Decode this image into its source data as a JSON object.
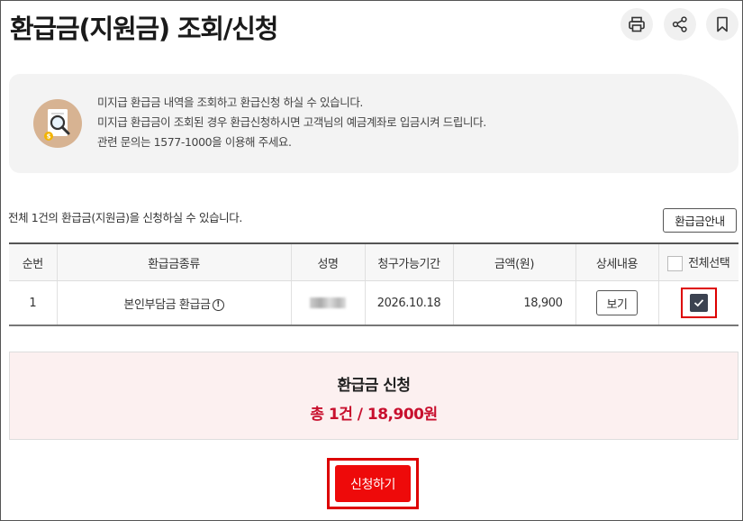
{
  "page": {
    "title": "환급금(지원금) 조회/신청"
  },
  "toolbar": {
    "print_icon": "printer-icon",
    "share_icon": "share-icon",
    "bookmark_icon": "bookmark-icon"
  },
  "info": {
    "icon": "magnifier-document-icon",
    "lines": [
      "미지급 환급금 내역을 조회하고 환급신청 하실 수 있습니다.",
      "미지급 환급금이 조회된 경우 환급신청하시면 고객님의 예금계좌로 입금시켜 드립니다.",
      "관련 문의는 1577-1000을 이용해 주세요."
    ]
  },
  "notice": "전체 1건의 환급금(지원금)을 신청하실 수 있습니다.",
  "guide_button": "환급금안내",
  "table": {
    "headers": {
      "no": "순번",
      "type": "환급금종류",
      "name": "성명",
      "period": "청구가능기간",
      "amount": "금액(원)",
      "detail": "상세내용",
      "select_all": "전체선택"
    },
    "rows": [
      {
        "no": "1",
        "type": "본인부담금 환급금",
        "name": "",
        "period": "2026.10.18",
        "amount": "18,900",
        "detail": "보기",
        "selected": true
      }
    ]
  },
  "summary": {
    "title": "환급금 신청",
    "total": "총 1건 / 18,900원"
  },
  "apply_button": "신청하기",
  "colors": {
    "accent_red": "#ee0a0a",
    "total_red": "#c8102e",
    "highlight_border": "#dd0000",
    "checkbox_fill": "#3b4250"
  }
}
